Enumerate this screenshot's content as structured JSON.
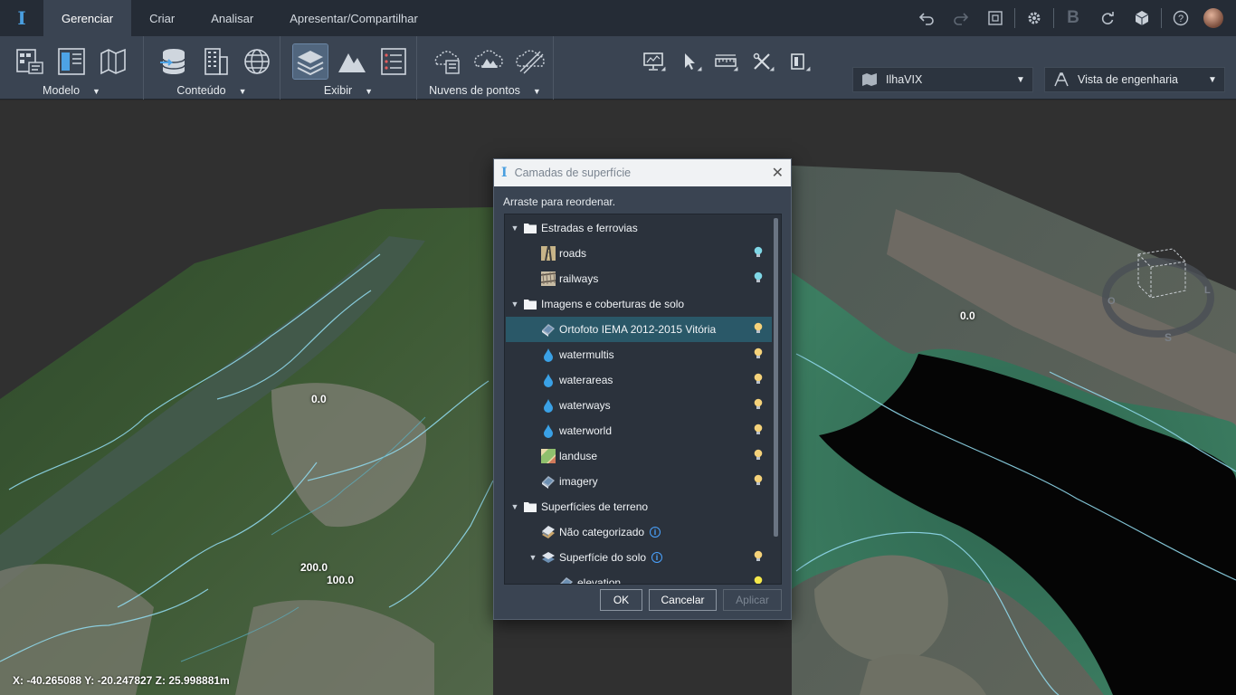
{
  "app": {
    "logo": "I"
  },
  "tabs": [
    "Gerenciar",
    "Criar",
    "Analisar",
    "Apresentar/Compartilhar"
  ],
  "active_tab": "Gerenciar",
  "quick_tools": [
    "undo-icon",
    "redo-icon",
    "fit-view-icon",
    "settings-icon",
    "bentley-icon",
    "sync-icon",
    "cube-icon",
    "help-icon",
    "avatar"
  ],
  "ribbon": {
    "groups": [
      {
        "label": "Modelo",
        "icons": [
          "model-properties-icon",
          "model-panel-icon",
          "model-map-icon"
        ]
      },
      {
        "label": "Conteúdo",
        "icons": [
          "database-icon",
          "buildings-icon",
          "globe-icon"
        ]
      },
      {
        "label": "Exibir",
        "icons": [
          "surface-layers-icon",
          "terrain-icon",
          "list-icon"
        ]
      },
      {
        "label": "Nuvens de pontos",
        "icons": [
          "point-cloud-icon",
          "point-cloud-terrain-icon",
          "point-cloud-slice-icon"
        ]
      }
    ],
    "view_tools": [
      "display-icon",
      "select-icon",
      "measure-icon",
      "tools-icon",
      "section-icon"
    ],
    "project_combo": {
      "value": "IlhaVIX"
    },
    "view_combo": {
      "value": "Vista de engenharia"
    }
  },
  "viewport": {
    "coords": "X: -40.265088 Y: -20.247827 Z: 25.998881m",
    "contour_labels": [
      "0.0",
      "0.0",
      "200.0",
      "100.0"
    ],
    "compass": {
      "west": "O",
      "east": "L",
      "south": "S"
    }
  },
  "dialog": {
    "title": "Camadas de superfície",
    "hint": "Arraste para reordenar.",
    "items": [
      {
        "label": "Estradas e ferrovias",
        "type": "folder",
        "level": 0,
        "expanded": true
      },
      {
        "label": "roads",
        "type": "roads",
        "level": 1,
        "bulb": "#7fd7e6"
      },
      {
        "label": "railways",
        "type": "railways",
        "level": 1,
        "bulb": "#7fd7e6"
      },
      {
        "label": "Imagens e coberturas de solo",
        "type": "folder",
        "level": 0,
        "expanded": true
      },
      {
        "label": "Ortofoto IEMA 2012-2015 Vitória",
        "type": "imagery",
        "level": 1,
        "bulb": "#f5d27a",
        "selected": true
      },
      {
        "label": "watermultis",
        "type": "water",
        "level": 1,
        "bulb": "#f5d27a"
      },
      {
        "label": "waterareas",
        "type": "water",
        "level": 1,
        "bulb": "#f5d27a"
      },
      {
        "label": "waterways",
        "type": "water",
        "level": 1,
        "bulb": "#f5d27a"
      },
      {
        "label": "waterworld",
        "type": "water",
        "level": 1,
        "bulb": "#f5d27a"
      },
      {
        "label": "landuse",
        "type": "landuse",
        "level": 1,
        "bulb": "#f5d27a"
      },
      {
        "label": "imagery",
        "type": "imagery",
        "level": 1,
        "bulb": "#f5d27a"
      },
      {
        "label": "Superfícies de terreno",
        "type": "folder",
        "level": 0,
        "expanded": true
      },
      {
        "label": "Não categorizado",
        "type": "terrain",
        "level": 1,
        "info": true
      },
      {
        "label": "Superfície do solo",
        "type": "surface",
        "level": 1,
        "info": true,
        "bulb": "#f5d27a",
        "expanded": true
      },
      {
        "label": "elevation",
        "type": "imagery",
        "level": 2,
        "bulb": "#f5e84a"
      }
    ],
    "buttons": {
      "ok": "OK",
      "cancel": "Cancelar",
      "apply": "Aplicar"
    }
  },
  "colors": {
    "accent": "#4a9fe0",
    "ribbon": "#3a4452",
    "tabbar": "#252c36",
    "selected_row": "#2a5868"
  }
}
